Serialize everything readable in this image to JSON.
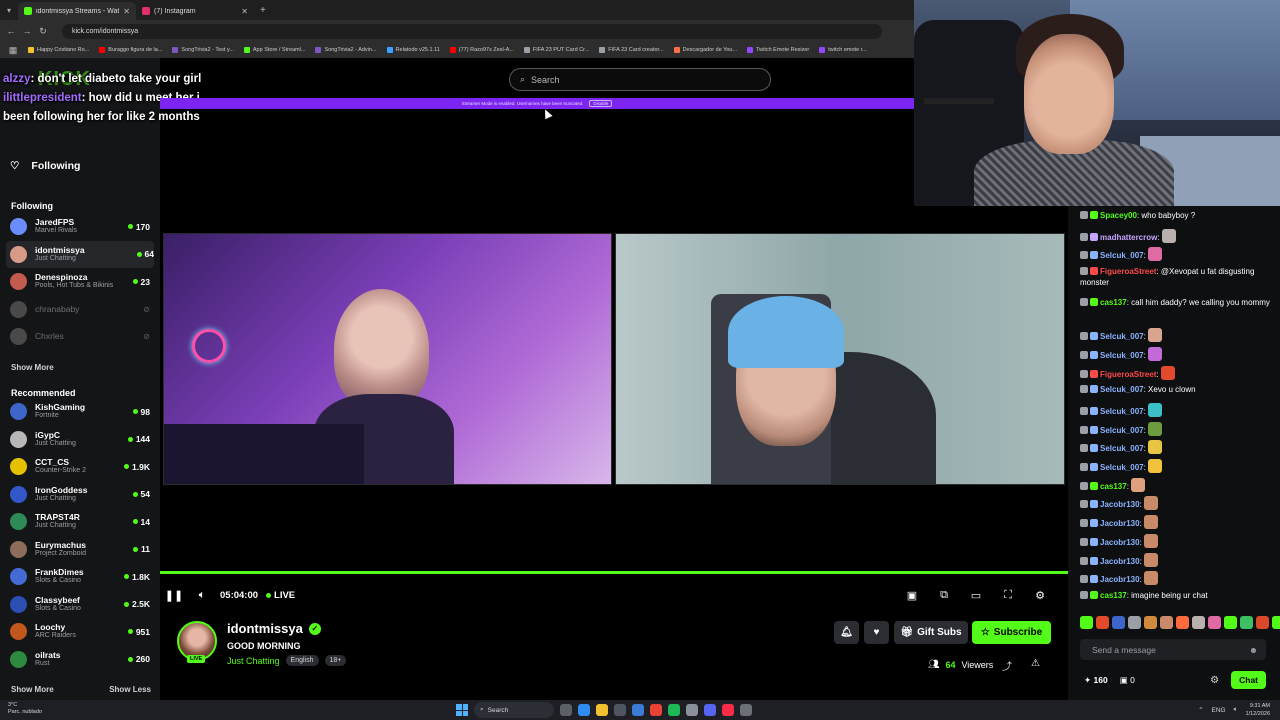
{
  "browser": {
    "tabs": [
      {
        "title": "idontmissya Streams - Watch",
        "color": "#53fc18",
        "active": true
      },
      {
        "title": "(7) Instagram",
        "color": "#e1306c",
        "active": false
      }
    ],
    "url": "kick.com/idontmissya",
    "bookmarks": [
      {
        "label": "Happy Cristiano Ro...",
        "color": "#f1c232"
      },
      {
        "label": "Buraggo figura de la...",
        "color": "#ff0000"
      },
      {
        "label": "SongTrivia2 - Test y...",
        "color": "#7e57c2"
      },
      {
        "label": "App Store / Streaml...",
        "color": "#53fc18"
      },
      {
        "label": "SongTrivia2 - Advin...",
        "color": "#7e57c2"
      },
      {
        "label": "Relatodo v25.1.11",
        "color": "#3aa3ff"
      },
      {
        "label": "(77) Razo97s Zesl-A...",
        "color": "#ff0000"
      },
      {
        "label": "FIFA 23 PUT Card Cr...",
        "color": "#9aa0a6"
      },
      {
        "label": "FIFA 23 Card creator...",
        "color": "#9aa0a6"
      },
      {
        "label": "Descargador de You...",
        "color": "#ff7043"
      },
      {
        "label": "Twitch Emote Resizer",
        "color": "#9146ff"
      },
      {
        "label": "twitch emote r...",
        "color": "#9146ff"
      }
    ]
  },
  "search": {
    "placeholder": "Search"
  },
  "banner": {
    "text": "Streamer Mode is enabled. Usernames have been truncated.",
    "button": "Disable"
  },
  "overlay_chat": [
    {
      "user": "alzzy",
      "text": ": don't let diabeto take your girl"
    },
    {
      "user": "ilittlepresident",
      "text": ": how did u meet her i been following her for like 2 months"
    }
  ],
  "sidebar": {
    "nav_following": "Following",
    "following_title": "Following",
    "following": [
      {
        "name": "JaredFPS",
        "category": "Marvel Rivals",
        "viewers": "170",
        "color": "#6b8cff"
      },
      {
        "name": "idontmissya",
        "category": "Just Chatting",
        "viewers": "64",
        "color": "#d79a86",
        "selected": true
      },
      {
        "name": "Denespinoza",
        "category": "Pools, Hot Tubs & Bikinis",
        "viewers": "23",
        "color": "#c45b4f"
      },
      {
        "name": "chranababy",
        "category": "",
        "viewers": "",
        "color": "#8a8a8a",
        "offline": true
      },
      {
        "name": "Chxrles",
        "category": "",
        "viewers": "",
        "color": "#8a8a8a",
        "offline": true
      }
    ],
    "show_more_1": "Show More",
    "recommended_title": "Recommended",
    "recommended": [
      {
        "name": "KishGaming",
        "category": "Fortnite",
        "viewers": "98",
        "color": "#3c66c9"
      },
      {
        "name": "iGypC",
        "category": "Just Chatting",
        "viewers": "144",
        "color": "#b7b7b7"
      },
      {
        "name": "CCT_CS",
        "category": "Counter-Strike 2",
        "viewers": "1.9K",
        "color": "#e5c100"
      },
      {
        "name": "IronGoddess",
        "category": "Just Chatting",
        "viewers": "54",
        "color": "#3157c9"
      },
      {
        "name": "TRAPST4R",
        "category": "Just Chatting",
        "viewers": "14",
        "color": "#2e8b57"
      },
      {
        "name": "Eurymachus",
        "category": "Project Zomboid",
        "viewers": "11",
        "color": "#8c6d5a"
      },
      {
        "name": "FrankDimes",
        "category": "Slots & Casino",
        "viewers": "1.8K",
        "color": "#446bd4"
      },
      {
        "name": "Classybeef",
        "category": "Slots & Casino",
        "viewers": "2.5K",
        "color": "#2b4fb3"
      },
      {
        "name": "Loochy",
        "category": "ARC Raiders",
        "viewers": "951",
        "color": "#c2571d"
      },
      {
        "name": "oilrats",
        "category": "Rust",
        "viewers": "260",
        "color": "#2d8a3e"
      }
    ],
    "show_more_2": "Show More",
    "show_less": "Show Less"
  },
  "player": {
    "time": "05:04:00",
    "live": "LIVE",
    "progress": 1.0
  },
  "stream": {
    "name": "idontmissya",
    "title": "GOOD MORNING",
    "category": "Just Chatting",
    "tags": [
      "English",
      "18+"
    ],
    "live_badge": "LIVE",
    "viewers": "64",
    "viewers_label": "Viewers",
    "gift_label": "Gift Subs",
    "subscribe_label": "Subscribe"
  },
  "chat": {
    "messages": [
      {
        "user": "Spacey00",
        "ucolor": "#53fc18",
        "text": ": who babyboy ?",
        "emote": ""
      },
      {
        "user": "madhattercrow",
        "ucolor": "#c7a5ff",
        "text": ":",
        "emote": "#b9b1ad"
      },
      {
        "user": "Selcuk_007",
        "ucolor": "#8ab4ff",
        "text": ":",
        "emote": "#e06aa3"
      },
      {
        "user": "FigueroaStreet",
        "ucolor": "#ff4a4a",
        "text": ": @Xevopat u fat disgusting monster",
        "emote": ""
      },
      {
        "user": "cas137",
        "ucolor": "#53fc18",
        "text": ": call him daddy? we calling you mommy",
        "emote": ""
      },
      {
        "user": "Selcuk_007",
        "ucolor": "#8ab4ff",
        "text": ":",
        "emote": "#d9a58f"
      },
      {
        "user": "Selcuk_007",
        "ucolor": "#8ab4ff",
        "text": ":",
        "emote": "#c26bd6"
      },
      {
        "user": "FigueroaStreet",
        "ucolor": "#ff4a4a",
        "text": ":",
        "emote": "#e24a2b"
      },
      {
        "user": "Selcuk_007",
        "ucolor": "#8ab4ff",
        "text": ": Xevo u clown",
        "emote": ""
      },
      {
        "user": "Selcuk_007",
        "ucolor": "#8ab4ff",
        "text": ":",
        "emote": "#3cc0c7"
      },
      {
        "user": "Selcuk_007",
        "ucolor": "#8ab4ff",
        "text": ":",
        "emote": "#6d9b3e"
      },
      {
        "user": "Selcuk_007",
        "ucolor": "#8ab4ff",
        "text": ":",
        "emote": "#e8c542"
      },
      {
        "user": "Selcuk_007",
        "ucolor": "#8ab4ff",
        "text": ":",
        "emote": "#f0c13a"
      },
      {
        "user": "cas137",
        "ucolor": "#53fc18",
        "text": ":",
        "emote": "#e0a080"
      },
      {
        "user": "Jacobr130",
        "ucolor": "#8ab4ff",
        "text": ":",
        "emote": "#c98a6a"
      },
      {
        "user": "Jacobr130",
        "ucolor": "#8ab4ff",
        "text": ":",
        "emote": "#c98a6a"
      },
      {
        "user": "Jacobr130",
        "ucolor": "#8ab4ff",
        "text": ":",
        "emote": "#c98a6a"
      },
      {
        "user": "Jacobr130",
        "ucolor": "#8ab4ff",
        "text": ":",
        "emote": "#c98a6a"
      },
      {
        "user": "Jacobr130",
        "ucolor": "#8ab4ff",
        "text": ":",
        "emote": "#c98a6a"
      },
      {
        "user": "cas137",
        "ucolor": "#53fc18",
        "text": ": imagine being ur chat",
        "emote": ""
      }
    ],
    "emote_bar": [
      "#53fc18",
      "#e24a2b",
      "#3c66c9",
      "#9aa0a6",
      "#d08a3e",
      "#c98a6a",
      "#ff6a3c",
      "#b9b1ad",
      "#e06aa3",
      "#53fc18",
      "#3cc063",
      "#d9482b",
      "#53fc18"
    ],
    "input_placeholder": "Send a message",
    "points": "160",
    "gifts": "0",
    "chat_button": "Chat"
  },
  "taskbar": {
    "weather_temp": "3°C",
    "weather_desc": "Parc. nublado",
    "search": "Search",
    "lang": "ENG",
    "time": "9:31 AM",
    "date": "1/12/2026"
  },
  "colors": {
    "accent": "#53fc18",
    "banner": "#7c25f0",
    "bg": "#000000",
    "sidebar": "#141517"
  }
}
